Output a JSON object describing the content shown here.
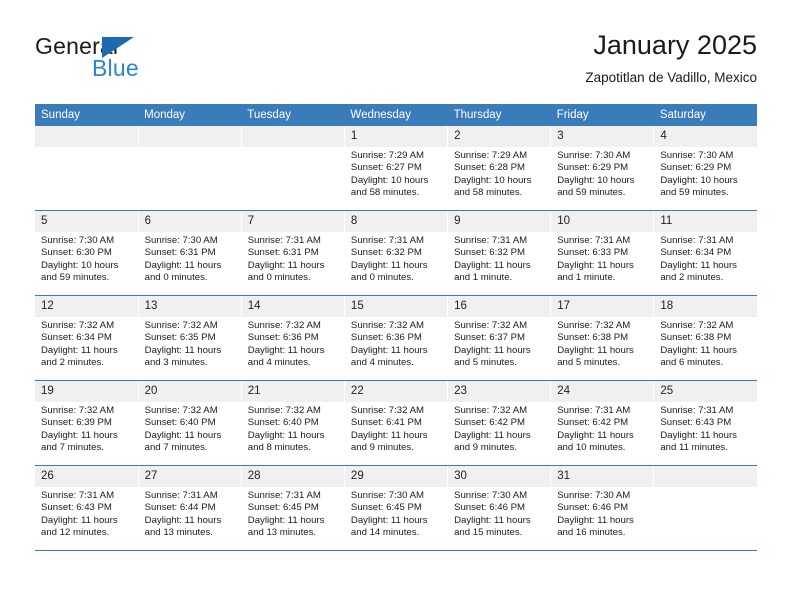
{
  "brand": {
    "word_top": "General",
    "word_bottom": "Blue",
    "triangle_icon": "triangle-icon",
    "accent_dark": "#1f69b0",
    "accent_blue": "#2b84d6"
  },
  "header": {
    "title": "January 2025",
    "subtitle": "Zapotitlan de Vadillo, Mexico"
  },
  "colors": {
    "header_bg": "#3a7cba",
    "header_text": "#ffffff",
    "daynum_bg": "#f0f0f0",
    "row_rule": "#3a7cba"
  },
  "weekdays": [
    "Sunday",
    "Monday",
    "Tuesday",
    "Wednesday",
    "Thursday",
    "Friday",
    "Saturday"
  ],
  "weeks": [
    [
      {
        "day": "",
        "lines": []
      },
      {
        "day": "",
        "lines": []
      },
      {
        "day": "",
        "lines": []
      },
      {
        "day": "1",
        "lines": [
          "Sunrise: 7:29 AM",
          "Sunset: 6:27 PM",
          "Daylight: 10 hours",
          "and 58 minutes."
        ]
      },
      {
        "day": "2",
        "lines": [
          "Sunrise: 7:29 AM",
          "Sunset: 6:28 PM",
          "Daylight: 10 hours",
          "and 58 minutes."
        ]
      },
      {
        "day": "3",
        "lines": [
          "Sunrise: 7:30 AM",
          "Sunset: 6:29 PM",
          "Daylight: 10 hours",
          "and 59 minutes."
        ]
      },
      {
        "day": "4",
        "lines": [
          "Sunrise: 7:30 AM",
          "Sunset: 6:29 PM",
          "Daylight: 10 hours",
          "and 59 minutes."
        ]
      }
    ],
    [
      {
        "day": "5",
        "lines": [
          "Sunrise: 7:30 AM",
          "Sunset: 6:30 PM",
          "Daylight: 10 hours",
          "and 59 minutes."
        ]
      },
      {
        "day": "6",
        "lines": [
          "Sunrise: 7:30 AM",
          "Sunset: 6:31 PM",
          "Daylight: 11 hours",
          "and 0 minutes."
        ]
      },
      {
        "day": "7",
        "lines": [
          "Sunrise: 7:31 AM",
          "Sunset: 6:31 PM",
          "Daylight: 11 hours",
          "and 0 minutes."
        ]
      },
      {
        "day": "8",
        "lines": [
          "Sunrise: 7:31 AM",
          "Sunset: 6:32 PM",
          "Daylight: 11 hours",
          "and 0 minutes."
        ]
      },
      {
        "day": "9",
        "lines": [
          "Sunrise: 7:31 AM",
          "Sunset: 6:32 PM",
          "Daylight: 11 hours",
          "and 1 minute."
        ]
      },
      {
        "day": "10",
        "lines": [
          "Sunrise: 7:31 AM",
          "Sunset: 6:33 PM",
          "Daylight: 11 hours",
          "and 1 minute."
        ]
      },
      {
        "day": "11",
        "lines": [
          "Sunrise: 7:31 AM",
          "Sunset: 6:34 PM",
          "Daylight: 11 hours",
          "and 2 minutes."
        ]
      }
    ],
    [
      {
        "day": "12",
        "lines": [
          "Sunrise: 7:32 AM",
          "Sunset: 6:34 PM",
          "Daylight: 11 hours",
          "and 2 minutes."
        ]
      },
      {
        "day": "13",
        "lines": [
          "Sunrise: 7:32 AM",
          "Sunset: 6:35 PM",
          "Daylight: 11 hours",
          "and 3 minutes."
        ]
      },
      {
        "day": "14",
        "lines": [
          "Sunrise: 7:32 AM",
          "Sunset: 6:36 PM",
          "Daylight: 11 hours",
          "and 4 minutes."
        ]
      },
      {
        "day": "15",
        "lines": [
          "Sunrise: 7:32 AM",
          "Sunset: 6:36 PM",
          "Daylight: 11 hours",
          "and 4 minutes."
        ]
      },
      {
        "day": "16",
        "lines": [
          "Sunrise: 7:32 AM",
          "Sunset: 6:37 PM",
          "Daylight: 11 hours",
          "and 5 minutes."
        ]
      },
      {
        "day": "17",
        "lines": [
          "Sunrise: 7:32 AM",
          "Sunset: 6:38 PM",
          "Daylight: 11 hours",
          "and 5 minutes."
        ]
      },
      {
        "day": "18",
        "lines": [
          "Sunrise: 7:32 AM",
          "Sunset: 6:38 PM",
          "Daylight: 11 hours",
          "and 6 minutes."
        ]
      }
    ],
    [
      {
        "day": "19",
        "lines": [
          "Sunrise: 7:32 AM",
          "Sunset: 6:39 PM",
          "Daylight: 11 hours",
          "and 7 minutes."
        ]
      },
      {
        "day": "20",
        "lines": [
          "Sunrise: 7:32 AM",
          "Sunset: 6:40 PM",
          "Daylight: 11 hours",
          "and 7 minutes."
        ]
      },
      {
        "day": "21",
        "lines": [
          "Sunrise: 7:32 AM",
          "Sunset: 6:40 PM",
          "Daylight: 11 hours",
          "and 8 minutes."
        ]
      },
      {
        "day": "22",
        "lines": [
          "Sunrise: 7:32 AM",
          "Sunset: 6:41 PM",
          "Daylight: 11 hours",
          "and 9 minutes."
        ]
      },
      {
        "day": "23",
        "lines": [
          "Sunrise: 7:32 AM",
          "Sunset: 6:42 PM",
          "Daylight: 11 hours",
          "and 9 minutes."
        ]
      },
      {
        "day": "24",
        "lines": [
          "Sunrise: 7:31 AM",
          "Sunset: 6:42 PM",
          "Daylight: 11 hours",
          "and 10 minutes."
        ]
      },
      {
        "day": "25",
        "lines": [
          "Sunrise: 7:31 AM",
          "Sunset: 6:43 PM",
          "Daylight: 11 hours",
          "and 11 minutes."
        ]
      }
    ],
    [
      {
        "day": "26",
        "lines": [
          "Sunrise: 7:31 AM",
          "Sunset: 6:43 PM",
          "Daylight: 11 hours",
          "and 12 minutes."
        ]
      },
      {
        "day": "27",
        "lines": [
          "Sunrise: 7:31 AM",
          "Sunset: 6:44 PM",
          "Daylight: 11 hours",
          "and 13 minutes."
        ]
      },
      {
        "day": "28",
        "lines": [
          "Sunrise: 7:31 AM",
          "Sunset: 6:45 PM",
          "Daylight: 11 hours",
          "and 13 minutes."
        ]
      },
      {
        "day": "29",
        "lines": [
          "Sunrise: 7:30 AM",
          "Sunset: 6:45 PM",
          "Daylight: 11 hours",
          "and 14 minutes."
        ]
      },
      {
        "day": "30",
        "lines": [
          "Sunrise: 7:30 AM",
          "Sunset: 6:46 PM",
          "Daylight: 11 hours",
          "and 15 minutes."
        ]
      },
      {
        "day": "31",
        "lines": [
          "Sunrise: 7:30 AM",
          "Sunset: 6:46 PM",
          "Daylight: 11 hours",
          "and 16 minutes."
        ]
      },
      {
        "day": "",
        "lines": []
      }
    ]
  ]
}
